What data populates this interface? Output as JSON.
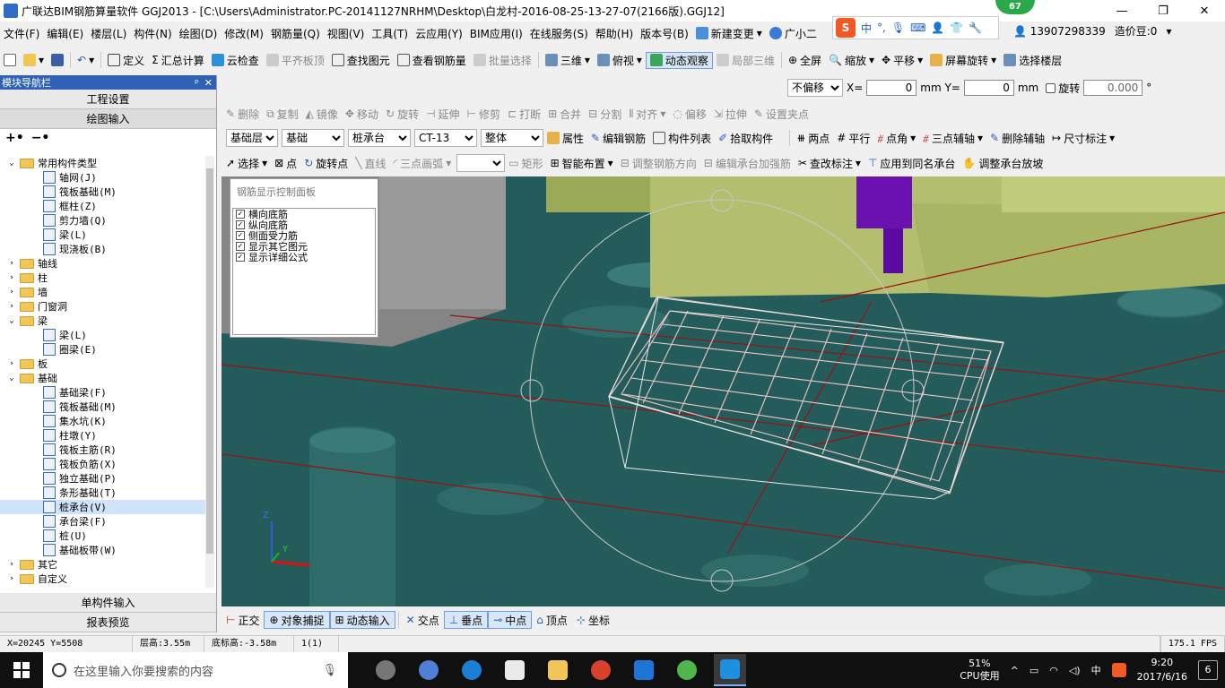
{
  "window": {
    "title": "广联达BIM钢筋算量软件 GGJ2013 - [C:\\Users\\Administrator.PC-20141127NRHM\\Desktop\\白龙村-2016-08-25-13-27-07(2166版).GGJ12]",
    "badge": "67",
    "minimize": "—",
    "restore": "❐",
    "close": "✕"
  },
  "menubar": {
    "items": [
      "文件(F)",
      "编辑(E)",
      "楼层(L)",
      "构件(N)",
      "绘图(D)",
      "修改(M)",
      "钢筋量(Q)",
      "视图(V)",
      "工具(T)",
      "云应用(Y)",
      "BIM应用(I)",
      "在线服务(S)",
      "帮助(H)",
      "版本号(B)"
    ],
    "new_change": "新建变更",
    "guangxiao": "广小二",
    "phone": "13907298339",
    "price_bean": "造价豆:0"
  },
  "ime": {
    "logo": "S",
    "lang": "中"
  },
  "toolbar1": {
    "define": "定义",
    "summary": "汇总计算",
    "cloud_check": "云检查",
    "flush_slab": "平齐板顶",
    "find_element": "查找图元",
    "view_rebar": "查看钢筋量",
    "batch_select": "批量选择",
    "three_d": "三维",
    "top_view": "俯视",
    "dynamic_view": "动态观察",
    "local_3d": "局部三维",
    "fullscreen": "全屏",
    "zoom": "缩放",
    "pan": "平移",
    "screen_rotate": "屏幕旋转",
    "select_floor": "选择楼层"
  },
  "toolbar2": {
    "offset_select": "不偏移",
    "x_label": "X=",
    "x_value": "0",
    "y_label": "mm Y=",
    "y_value": "0",
    "mm": "mm",
    "rotate_label": "旋转",
    "rotate_value": "0.000",
    "degree": "°"
  },
  "toolbar3": {
    "delete": "删除",
    "copy": "复制",
    "mirror": "镜像",
    "move": "移动",
    "rotate": "旋转",
    "extend": "延伸",
    "trim": "修剪",
    "break": "打断",
    "merge": "合并",
    "split": "分割",
    "align": "对齐",
    "offset": "偏移",
    "stretch": "拉伸",
    "set_grip": "设置夹点"
  },
  "toolbar4": {
    "layer": "基础层",
    "category": "基础",
    "component_type": "桩承台",
    "component_name": "CT-13",
    "whole": "整体",
    "properties": "属性",
    "edit_rebar": "编辑钢筋",
    "component_list": "构件列表",
    "pick_component": "拾取构件",
    "two_points": "两点",
    "parallel": "平行",
    "point_angle": "点角",
    "three_point_axis": "三点辅轴",
    "delete_axis": "删除辅轴",
    "dimension": "尺寸标注"
  },
  "toolbar5": {
    "select": "选择",
    "point": "点",
    "rotate_point": "旋转点",
    "line": "直线",
    "arc": "三点画弧",
    "rect": "矩形",
    "smart_layout": "智能布置",
    "adjust_rebar_dir": "调整钢筋方向",
    "edit_cap_rebar": "编辑承台加强筋",
    "modify_label": "查改标注",
    "apply_same": "应用到同名承台",
    "adjust_slope": "调整承台放坡"
  },
  "sidebar": {
    "header": "模块导航栏",
    "pin": "ᵖ",
    "close": "✕",
    "project_settings": "工程设置",
    "drawing_input": "绘图输入",
    "tree": [
      {
        "label": "常用构件类型",
        "level": 0,
        "type": "folder",
        "expanded": true
      },
      {
        "label": "轴网(J)",
        "level": 1,
        "type": "item"
      },
      {
        "label": "筏板基础(M)",
        "level": 1,
        "type": "item"
      },
      {
        "label": "框柱(Z)",
        "level": 1,
        "type": "item"
      },
      {
        "label": "剪力墙(Q)",
        "level": 1,
        "type": "item"
      },
      {
        "label": "梁(L)",
        "level": 1,
        "type": "item"
      },
      {
        "label": "现浇板(B)",
        "level": 1,
        "type": "item"
      },
      {
        "label": "轴线",
        "level": 0,
        "type": "folder",
        "expanded": false
      },
      {
        "label": "柱",
        "level": 0,
        "type": "folder",
        "expanded": false
      },
      {
        "label": "墙",
        "level": 0,
        "type": "folder",
        "expanded": false
      },
      {
        "label": "门窗洞",
        "level": 0,
        "type": "folder",
        "expanded": false
      },
      {
        "label": "梁",
        "level": 0,
        "type": "folder",
        "expanded": true
      },
      {
        "label": "梁(L)",
        "level": 1,
        "type": "item"
      },
      {
        "label": "圈梁(E)",
        "level": 1,
        "type": "item"
      },
      {
        "label": "板",
        "level": 0,
        "type": "folder",
        "expanded": false
      },
      {
        "label": "基础",
        "level": 0,
        "type": "folder",
        "expanded": true
      },
      {
        "label": "基础梁(F)",
        "level": 1,
        "type": "item"
      },
      {
        "label": "筏板基础(M)",
        "level": 1,
        "type": "item"
      },
      {
        "label": "集水坑(K)",
        "level": 1,
        "type": "item"
      },
      {
        "label": "柱墩(Y)",
        "level": 1,
        "type": "item"
      },
      {
        "label": "筏板主筋(R)",
        "level": 1,
        "type": "item"
      },
      {
        "label": "筏板负筋(X)",
        "level": 1,
        "type": "item"
      },
      {
        "label": "独立基础(P)",
        "level": 1,
        "type": "item"
      },
      {
        "label": "条形基础(T)",
        "level": 1,
        "type": "item"
      },
      {
        "label": "桩承台(V)",
        "level": 1,
        "type": "item",
        "selected": true
      },
      {
        "label": "承台梁(F)",
        "level": 1,
        "type": "item"
      },
      {
        "label": "桩(U)",
        "level": 1,
        "type": "item"
      },
      {
        "label": "基础板带(W)",
        "level": 1,
        "type": "item"
      },
      {
        "label": "其它",
        "level": 0,
        "type": "folder",
        "expanded": false
      },
      {
        "label": "自定义",
        "level": 0,
        "type": "folder",
        "expanded": false
      }
    ],
    "single_component_input": "单构件输入",
    "report_preview": "报表预览"
  },
  "control_panel": {
    "title": "钢筋显示控制面板",
    "items": [
      "横向底筋",
      "纵向底筋",
      "侧面受力筋",
      "显示其它图元",
      "显示详细公式"
    ]
  },
  "axis_labels": {
    "z": "Z",
    "y": "Y"
  },
  "snapbar": {
    "ortho": "正交",
    "object_snap": "对象捕捉",
    "dynamic_input": "动态输入",
    "intersection": "交点",
    "perpendicular": "垂点",
    "midpoint": "中点",
    "vertex": "顶点",
    "coordinate": "坐标"
  },
  "statusbar": {
    "coords": "X=20245 Y=5508",
    "floor_height": "层高:3.55m",
    "bottom_height": "底标高:-3.58m",
    "count": "1(1)",
    "fps": "175.1 FPS"
  },
  "taskbar": {
    "search_placeholder": "在这里输入你要搜索的内容",
    "cpu_percent": "51%",
    "cpu_label": "CPU使用",
    "ime": "中",
    "time": "9:20",
    "date": "2017/6/16",
    "notif_count": "6"
  },
  "colors": {
    "viewport_bg": "#235c5a",
    "slab": "#b3bf6e",
    "column_purple": "#6a11b0",
    "rebar": "#f0c8c8",
    "accent_blue": "#2f62b4"
  }
}
